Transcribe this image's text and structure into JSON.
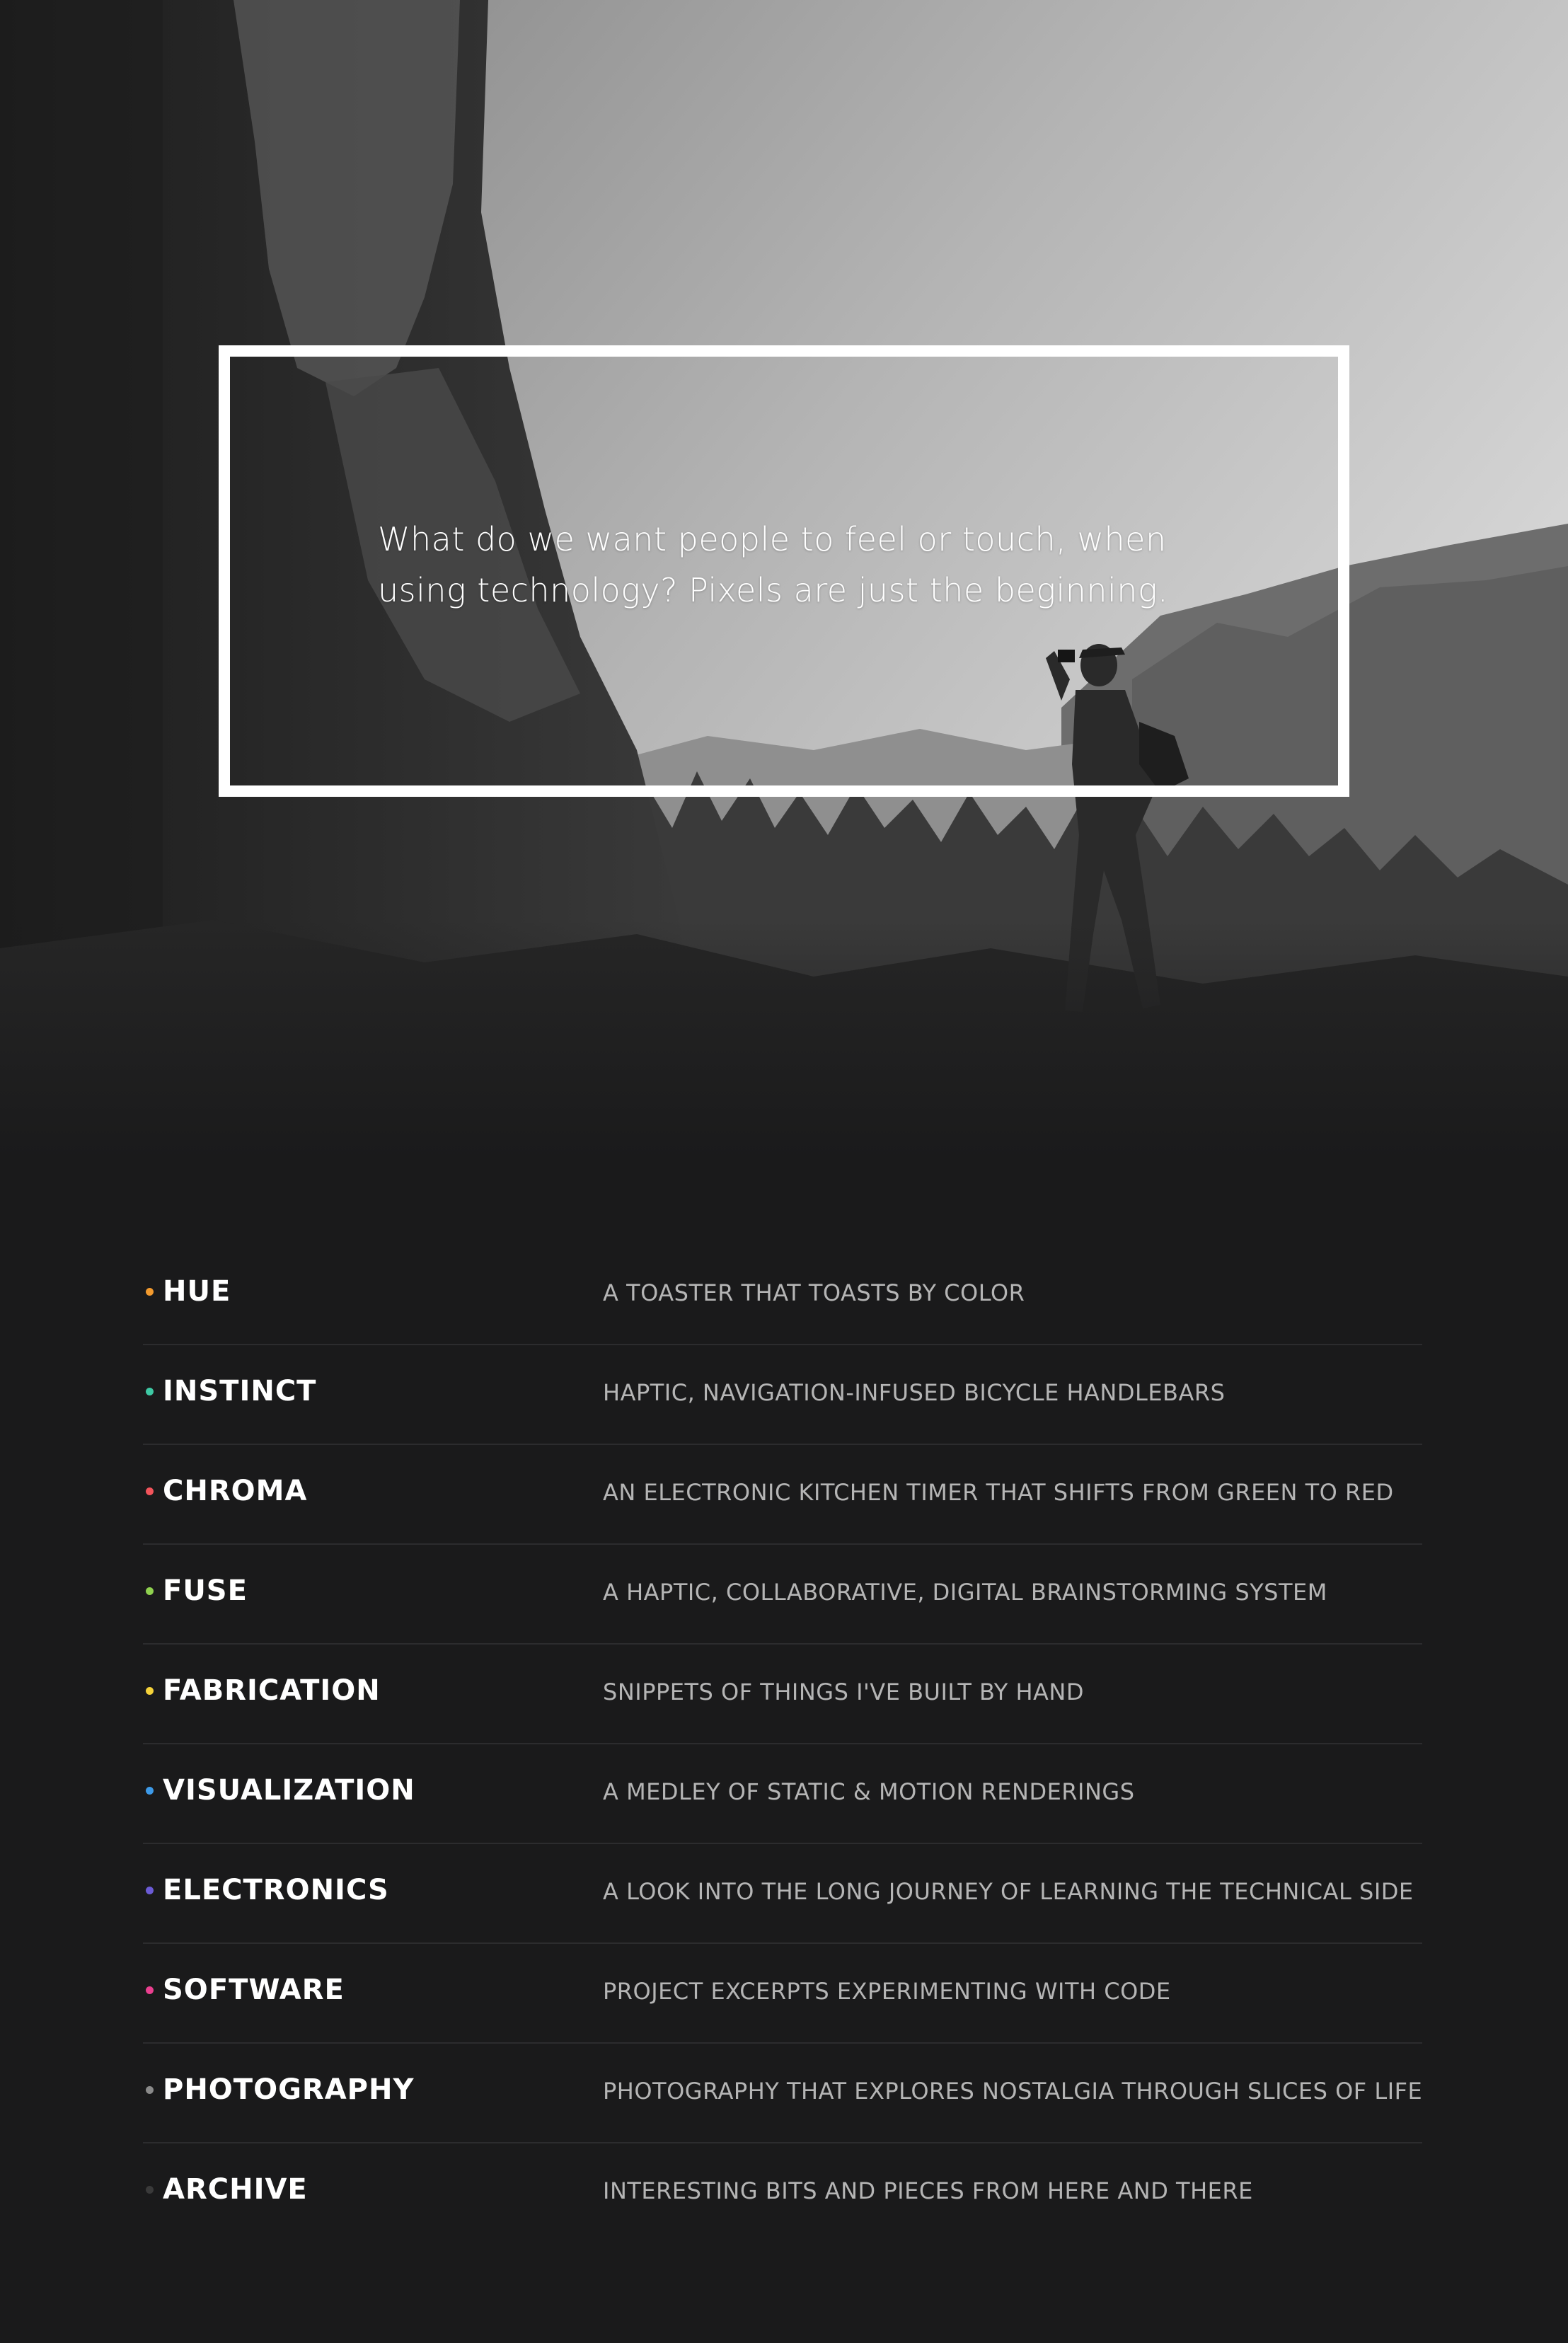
{
  "hero": {
    "quote_line1": "What do we want people to feel or touch, when",
    "quote_line2": "using technology? Pixels are just the beginning."
  },
  "projects": [
    {
      "name": "HUE",
      "description": "A TOASTER THAT TOASTS BY COLOR",
      "dot_color": "#f29a2e"
    },
    {
      "name": "INSTINCT",
      "description": "HAPTIC, NAVIGATION-INFUSED BICYCLE HANDLEBARS",
      "dot_color": "#3ec9a4"
    },
    {
      "name": "CHROMA",
      "description": "AN ELECTRONIC KITCHEN TIMER THAT SHIFTS FROM GREEN TO RED",
      "dot_color": "#f2545b"
    },
    {
      "name": "FUSE",
      "description": "A HAPTIC, COLLABORATIVE, DIGITAL BRAINSTORMING SYSTEM",
      "dot_color": "#8fd14f"
    },
    {
      "name": "FABRICATION",
      "description": "SNIPPETS OF THINGS I'VE BUILT BY HAND",
      "dot_color": "#f5d23a"
    },
    {
      "name": "VISUALIZATION",
      "description": "A MEDLEY OF STATIC & MOTION RENDERINGS",
      "dot_color": "#3d9ae8"
    },
    {
      "name": "ELECTRONICS",
      "description": "A LOOK INTO THE LONG JOURNEY OF LEARNING THE TECHNICAL SIDE",
      "dot_color": "#6b5bd6"
    },
    {
      "name": "SOFTWARE",
      "description": "PROJECT EXCERPTS EXPERIMENTING WITH CODE",
      "dot_color": "#ea3f8f"
    },
    {
      "name": "PHOTOGRAPHY",
      "description": "PHOTOGRAPHY THAT EXPLORES NOSTALGIA THROUGH SLICES OF LIFE",
      "dot_color": "#8a8a8a"
    },
    {
      "name": "ARCHIVE",
      "description": "INTERESTING BITS AND PIECES FROM HERE AND THERE",
      "dot_color": "#3a3a3a"
    }
  ]
}
